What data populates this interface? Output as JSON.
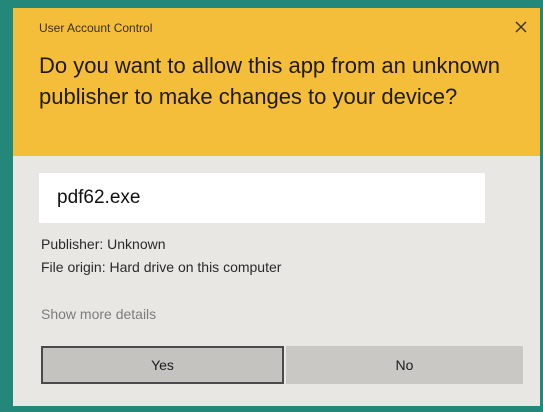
{
  "dialog": {
    "title": "User Account Control",
    "question": "Do you want to allow this app from an unknown publisher to make changes to your device?",
    "app_name": "pdf62.exe",
    "publisher": "Publisher: Unknown",
    "file_origin": "File origin: Hard drive on this computer",
    "show_more_details": "Show more details",
    "yes_label": "Yes",
    "no_label": "No",
    "close_icon": "close-icon"
  },
  "colors": {
    "header": "#f4bd3a",
    "body": "#e8e7e3",
    "frame": "#23877a"
  }
}
